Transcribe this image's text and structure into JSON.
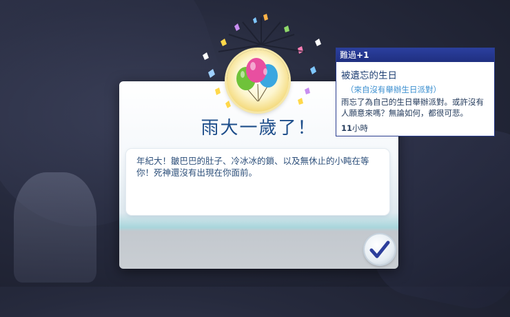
{
  "dialog": {
    "title": "雨大一歲了！",
    "message": "年紀大！皺巴巴的肚子、冷冰冰的鎖、以及無休止的小盹在等你！死神還沒有出現在你面前。",
    "confirm_icon": "checkmark-icon"
  },
  "celebration": {
    "icon": "balloons-icon",
    "balloon_colors": [
      "#e84fa0",
      "#6fc23a",
      "#3aa7e0"
    ]
  },
  "moodlet": {
    "emotion": "難過",
    "strength": "+1",
    "name": "被遺忘的生日",
    "source": "（來自沒有舉辦生日派對）",
    "description": "雨忘了為自己的生日舉辦派對。或許沒有人願意來嗎？無論如何，都很可悲。",
    "time_value": "11",
    "time_unit": "小時",
    "header_color": "#2b3f9e"
  }
}
